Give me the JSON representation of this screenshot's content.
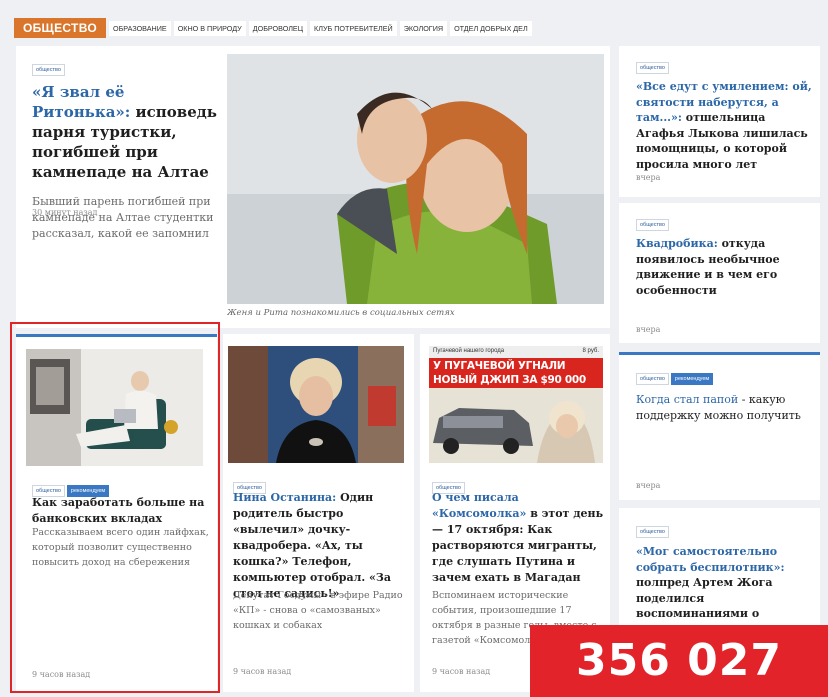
{
  "header": {
    "section": "ОБЩЕСТВО",
    "nav": [
      "ОБРАЗОВАНИЕ",
      "ОКНО В ПРИРОДУ",
      "ДОБРОВОЛЕЦ",
      "КЛУБ ПОТРЕБИТЕЛЕЙ",
      "ЭКОЛОГИЯ",
      "ОТДЕЛ ДОБРЫХ ДЕЛ"
    ]
  },
  "tags": {
    "society": "общество",
    "recommend": "рекомендуем"
  },
  "lead_article": {
    "headline_kw": "«Я звал её Ритонька»:",
    "headline_rest": " исповедь парня туристки, погибшей при камнепаде на Алтае",
    "lead": "Бывший парень погибшей при камнепаде на Алтае студентки рассказал, какой ее запомнил",
    "time": "30 минут назад",
    "photo_caption": "Женя и Рита познакомились в социальных сетях"
  },
  "right_column": [
    {
      "headline_kw": "«Все едут с умилением: ой, святости наберутся, а там...»:",
      "headline_rest": " отшельница Агафья Лыкова лишилась помощницы, о которой просила много лет",
      "time": "вчера"
    },
    {
      "headline_kw": "Квадробика:",
      "headline_rest": " откуда появилось необычное движение и в чем его особенности",
      "time": "вчера"
    },
    {
      "headline_kw": "Когда стал папой",
      "headline_rest": " - какую поддержку можно получить",
      "time": "вчера"
    },
    {
      "headline_kw": "«Мог самостоятельно собрать беспилотник»:",
      "headline_rest": " полпред Артем Жога поделился воспоминаниями о «Моторолe» в годовщину его гибели"
    }
  ],
  "bottom_row": [
    {
      "headline": "Как заработать больше на банковских вкладах",
      "lead": "Рассказываем всего один лайфхак, который позволит существенно повысить доход на сбережения",
      "time": "9 часов назад"
    },
    {
      "headline_kw": "Нина Останина:",
      "headline_rest": " Один родитель быстро «вылечил» дочку-квадробера. «Ах, ты кошка?» Телефон, компьютер отобрал. «За стол не садись!»",
      "lead": "Депутат Госдумы - в эфире Радио «КП» - снова о «самозваных» кошках и собаках",
      "time": "9 часов назад"
    },
    {
      "headline_kw": "О чем писала «Комсомолка»",
      "headline_rest": " в этот день — 17 октября: Как растворяются мигранты, где слушать Путина и зачем ехать в Магадан",
      "lead": "Вспоминаем исторические события, произошедшие 17 октября в разные годы, вместе с газетой «Комсомольская правда»",
      "time": "9 часов назад"
    }
  ],
  "newspaper": {
    "masthead": "Пугачевой нашего города",
    "price": "8 руб.",
    "headline": "У ПУГАЧЕВОЙ УГНАЛИ НОВЫЙ ДЖИП ЗА $90 000"
  },
  "counter": "356 027"
}
